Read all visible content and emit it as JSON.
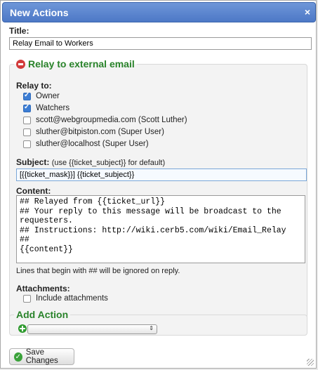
{
  "dialog": {
    "title": "New Actions",
    "close_symbol": "×"
  },
  "title_field": {
    "label": "Title:",
    "value": "Relay Email to Workers"
  },
  "relay": {
    "legend": "Relay to external email",
    "relay_to_label": "Relay to:",
    "recipients": [
      {
        "label": "Owner",
        "checked": true
      },
      {
        "label": "Watchers",
        "checked": true
      },
      {
        "label": "scott@webgroupmedia.com (Scott Luther)",
        "checked": false
      },
      {
        "label": "sluther@bitpiston.com (Super User)",
        "checked": false
      },
      {
        "label": "sluther@localhost (Super User)",
        "checked": false
      }
    ],
    "subject_label": "Subject:",
    "subject_hint": "(use {{ticket_subject}} for default)",
    "subject_value": "[{{ticket_mask}}] {{ticket_subject}}",
    "content_label": "Content:",
    "content_value": "## Relayed from {{ticket_url}}\n## Your reply to this message will be broadcast to the\nrequesters.\n## Instructions: http://wiki.cerb5.com/wiki/Email_Relay\n##\n{{content}}",
    "content_note": "Lines that begin with ## will be ignored on reply.",
    "attachments_label": "Attachments:",
    "include_attachments_label": "Include attachments",
    "include_attachments_checked": false
  },
  "add_action": {
    "legend": "Add Action",
    "selected": ""
  },
  "save_button": {
    "label": "Save Changes"
  }
}
